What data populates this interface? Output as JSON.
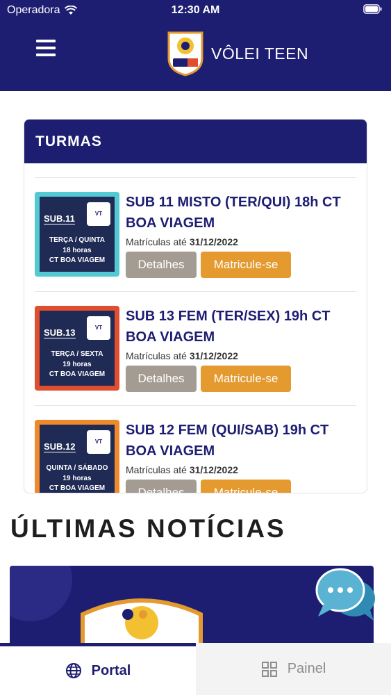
{
  "status_bar": {
    "carrier": "Operadora",
    "time": "12:30 AM"
  },
  "header": {
    "brand_title": "VÔLEI TEEN",
    "logo_text": "vôlei TEEN"
  },
  "turmas": {
    "title": "TURMAS",
    "deadline_label": "Matrículas até",
    "details_label": "Detalhes",
    "enroll_label": "Matricule-se",
    "items": [
      {
        "title": "SUB 11 MISTO (TER/QUI) 18h CT BOA VIAGEM",
        "deadline": "31/12/2022",
        "thumb_sub": "SUB.11",
        "thumb_days": "TERÇA / QUINTA",
        "thumb_hours": "18 horas",
        "thumb_place": "CT BOA VIAGEM",
        "thumb_color": "#52c9d3"
      },
      {
        "title": "SUB 13 FEM (TER/SEX) 19h CT BOA VIAGEM",
        "deadline": "31/12/2022",
        "thumb_sub": "SUB.13",
        "thumb_days": "TERÇA / SEXTA",
        "thumb_hours": "19 horas",
        "thumb_place": "CT BOA VIAGEM",
        "thumb_color": "#e04e30"
      },
      {
        "title": "SUB 12 FEM (QUI/SAB) 19h CT BOA VIAGEM",
        "deadline": "31/12/2022",
        "thumb_sub": "SUB.12",
        "thumb_days": "QUINTA / SÁBADO",
        "thumb_hours": "19 horas",
        "thumb_place": "CT BOA VIAGEM",
        "thumb_color": "#ee8a2c"
      }
    ]
  },
  "news": {
    "title": "ÚLTIMAS NOTÍCIAS"
  },
  "tabbar": {
    "portal_label": "Portal",
    "painel_label": "Painel"
  },
  "colors": {
    "primary": "#1d1d72",
    "accent": "#e49a2f",
    "secondary_button": "#a49c92"
  },
  "icons": {
    "menu": "hamburger-icon",
    "portal": "globe-icon",
    "painel": "grid-icon",
    "chat": "chat-bubbles-icon"
  }
}
